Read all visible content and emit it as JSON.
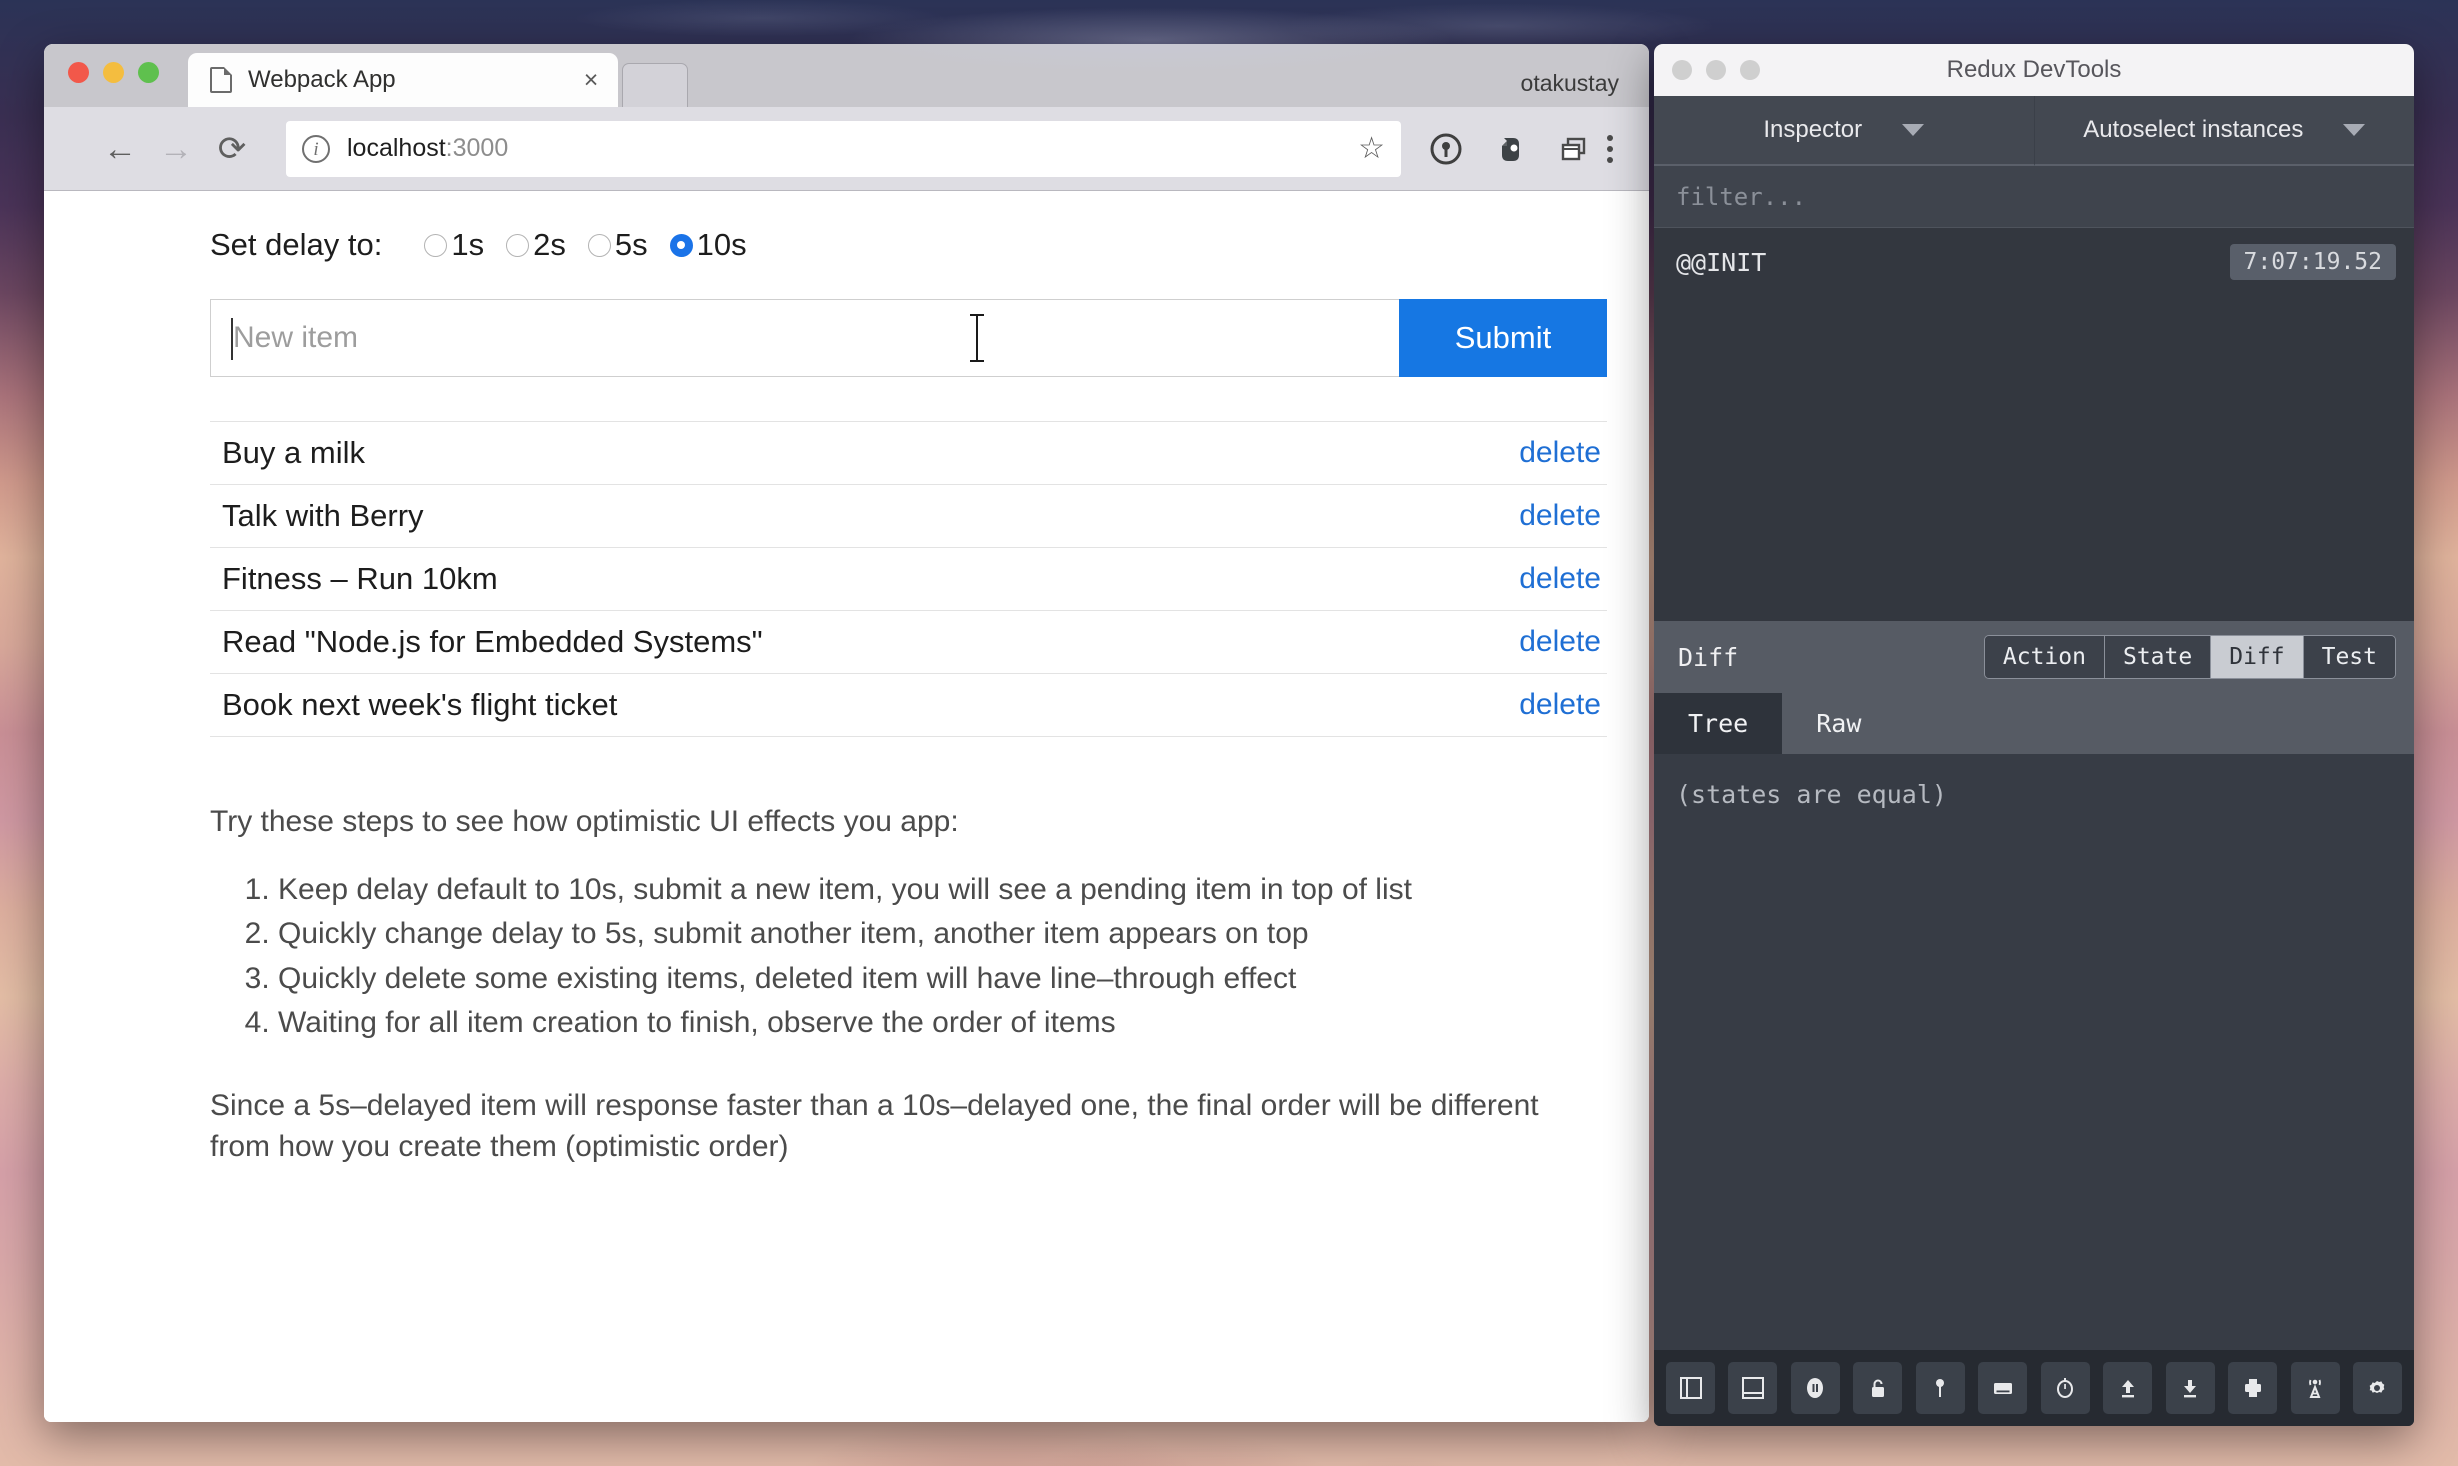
{
  "browser": {
    "tab": {
      "title": "Webpack App",
      "close_label": "×",
      "favicon": "page-icon"
    },
    "profile": "otakustay",
    "toolbar": {
      "back": "←",
      "forward": "→",
      "reload": "⟳",
      "url_host": "localhost",
      "url_port": ":3000",
      "star": "☆",
      "extensions": [
        "password-manager-icon",
        "evernote-icon",
        "window-copy-icon"
      ],
      "menu": "three-dot-menu-icon"
    }
  },
  "page": {
    "delay": {
      "label": "Set delay to:",
      "options": [
        {
          "label": "1s",
          "checked": false
        },
        {
          "label": "2s",
          "checked": false
        },
        {
          "label": "5s",
          "checked": false
        },
        {
          "label": "10s",
          "checked": true
        }
      ]
    },
    "form": {
      "placeholder": "New item",
      "value": "",
      "submit_label": "Submit"
    },
    "todos": [
      {
        "text": "Buy a milk",
        "delete_label": "delete"
      },
      {
        "text": "Talk with Berry",
        "delete_label": "delete"
      },
      {
        "text": "Fitness – Run 10km",
        "delete_label": "delete"
      },
      {
        "text": "Read \"Node.js for Embedded Systems\"",
        "delete_label": "delete"
      },
      {
        "text": "Book next week's flight ticket",
        "delete_label": "delete"
      }
    ],
    "intro": "Try these steps to see how optimistic UI effects you app:",
    "steps": [
      "Keep delay default to 10s, submit a new item, you will see a pending item in top of list",
      "Quickly change delay to 5s, submit another item, another item appears on top",
      "Quickly delete some existing items, deleted item will have line–through effect",
      "Waiting for all item creation to finish, observe the order of items"
    ],
    "closing": "Since a 5s–delayed item will response faster than a 10s–delayed one, the final order will be different from how you create them (optimistic order)"
  },
  "devtools": {
    "title": "Redux DevTools",
    "selectors": [
      {
        "label": "Inspector"
      },
      {
        "label": "Autoselect instances"
      }
    ],
    "filter_placeholder": "filter...",
    "actions": [
      {
        "name": "@@INIT",
        "time": "7:07:19.52"
      }
    ],
    "diff_bar": {
      "label": "Diff",
      "segments": [
        {
          "label": "Action",
          "active": false
        },
        {
          "label": "State",
          "active": false
        },
        {
          "label": "Diff",
          "active": true
        },
        {
          "label": "Test",
          "active": false
        }
      ]
    },
    "subtabs": [
      {
        "label": "Tree",
        "active": true
      },
      {
        "label": "Raw",
        "active": false
      }
    ],
    "panel_message": "(states are equal)",
    "bottom_tools": [
      "dock-right-icon",
      "dock-bottom-icon",
      "pause-icon",
      "lock-icon",
      "pin-icon",
      "keyboard-icon",
      "timer-icon",
      "upload-icon",
      "download-icon",
      "print-icon",
      "broadcast-icon",
      "gear-icon"
    ]
  },
  "colors": {
    "accent_blue": "#1677e3",
    "link_blue": "#1f6fd4",
    "radio_blue": "#1a73e8",
    "devtools_bg": "#3b4049"
  }
}
